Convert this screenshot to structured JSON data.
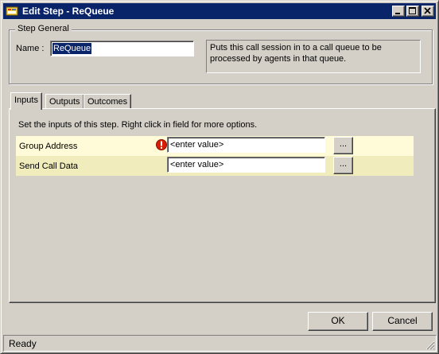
{
  "window": {
    "title": "Edit Step - ReQueue"
  },
  "step_general": {
    "legend": "Step General",
    "name_label": "Name :",
    "name_value": "ReQueue",
    "description_line1": "Puts this call session in to a call queue to be",
    "description_line2": "processed by agents in that queue."
  },
  "tabs": [
    {
      "label": "Inputs",
      "selected": true
    },
    {
      "label": "Outputs",
      "selected": false
    },
    {
      "label": "Outcomes",
      "selected": false
    }
  ],
  "inputs_panel": {
    "instructions": "Set the inputs of this step.  Right click in field for more options.",
    "rows": [
      {
        "label": "Group Address",
        "value": "<enter value>",
        "has_error": true,
        "browse_label": "..."
      },
      {
        "label": "Send Call Data",
        "value": "<enter value>",
        "has_error": false,
        "browse_label": "..."
      }
    ]
  },
  "buttons": {
    "ok": "OK",
    "cancel": "Cancel"
  },
  "status": {
    "text": "Ready"
  },
  "icons": {
    "app": "step-editor-icon",
    "error": "error-icon",
    "minimize": "minimize-icon",
    "maximize": "maximize-icon",
    "close": "close-icon",
    "grip": "resize-grip-icon"
  },
  "colors": {
    "title_bar": "#0a246a",
    "row_light": "#fffbd9",
    "row_dark": "#f0ecbc",
    "error": "#d81e05"
  }
}
